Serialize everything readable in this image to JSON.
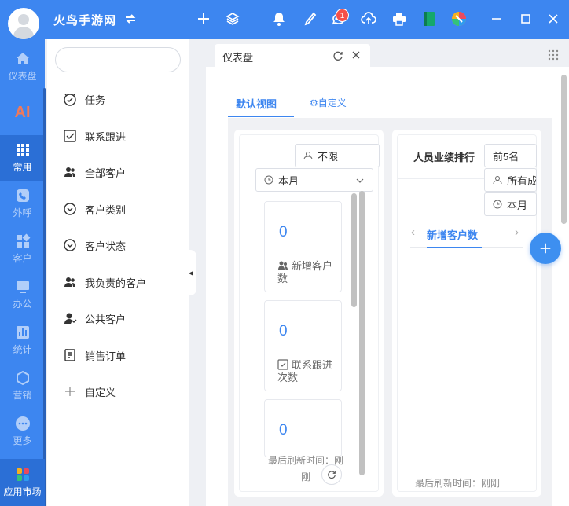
{
  "app": {
    "title": "火鸟手游网"
  },
  "topbar": {
    "notification_badge": "1",
    "icons": [
      "sync-icon",
      "plus-icon",
      "layers-icon",
      "bell-icon",
      "phone-icon",
      "chat-icon",
      "cloud-upload-icon",
      "printer-icon",
      "book-icon",
      "color-app-icon",
      "minimize-icon",
      "maximize-icon",
      "close-icon"
    ]
  },
  "rail": {
    "items": [
      {
        "label": "仪表盘",
        "icon": "home-icon"
      },
      {
        "label": "AI",
        "icon": "ai-icon"
      },
      {
        "label": "常用",
        "icon": "grid-icon"
      },
      {
        "label": "外呼",
        "icon": "phone-icon"
      },
      {
        "label": "客户",
        "icon": "customer-icon"
      },
      {
        "label": "办公",
        "icon": "monitor-icon"
      },
      {
        "label": "统计",
        "icon": "chart-icon"
      },
      {
        "label": "营销",
        "icon": "hexagon-icon"
      },
      {
        "label": "更多",
        "icon": "more-icon"
      }
    ],
    "market_label": "应用市场",
    "active": "常用"
  },
  "menu": {
    "search_placeholder": "",
    "items": [
      {
        "label": "任务",
        "icon": "clock-icon"
      },
      {
        "label": "联系跟进",
        "icon": "checkbox-icon"
      },
      {
        "label": "全部客户",
        "icon": "users-icon"
      },
      {
        "label": "客户类别",
        "icon": "chevron-circle-icon"
      },
      {
        "label": "客户状态",
        "icon": "chevron-circle-icon"
      },
      {
        "label": "我负责的客户",
        "icon": "users-icon"
      },
      {
        "label": "公共客户",
        "icon": "user-icon"
      },
      {
        "label": "销售订单",
        "icon": "order-icon"
      },
      {
        "label": "自定义",
        "icon": "plus-icon"
      }
    ]
  },
  "tabs": [
    {
      "label": "仪表盘"
    }
  ],
  "dashboard": {
    "views": {
      "default": "默认视图",
      "custom": "自定义"
    },
    "left_card": {
      "filter_owner": "不限",
      "filter_period": "本月",
      "stats": [
        {
          "value": "0",
          "label": "新增客户数"
        },
        {
          "value": "0",
          "label": "联系跟进次数"
        },
        {
          "value": "0",
          "label": ""
        }
      ],
      "refresh_text": "最后刷新时间：刚刚"
    },
    "right_card": {
      "title": "人员业绩排行",
      "filter_top": "前5名",
      "filter_scope": "所有成",
      "filter_period": "本月",
      "active_tab": "新增客户数",
      "refresh_text": "最后刷新时间：刚刚"
    }
  },
  "colors": {
    "primary": "#3d86f0",
    "rail_active": "#2b6fd6",
    "badge": "#f5504a"
  }
}
